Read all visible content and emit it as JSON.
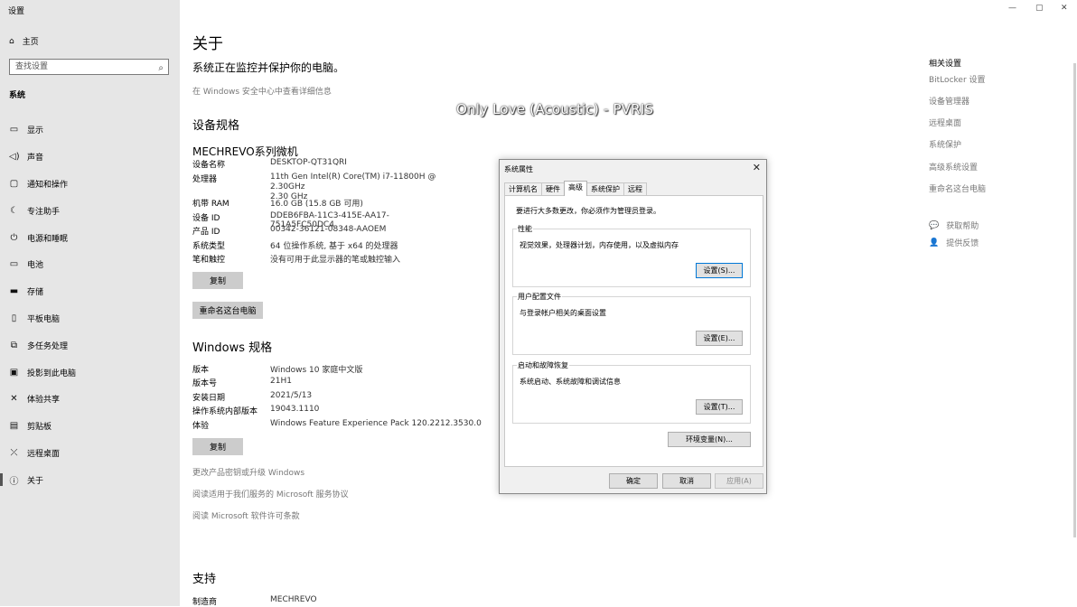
{
  "window": {
    "title": "设置",
    "controls": [
      "—",
      "▢",
      "✕"
    ]
  },
  "sidebar": {
    "home": "主页",
    "search_placeholder": "查找设置",
    "section": "系统",
    "items": [
      {
        "label": "显示",
        "icon": "display-icon"
      },
      {
        "label": "声音",
        "icon": "sound-icon"
      },
      {
        "label": "通知和操作",
        "icon": "notification-icon"
      },
      {
        "label": "专注助手",
        "icon": "moon-icon"
      },
      {
        "label": "电源和睡眠",
        "icon": "power-icon"
      },
      {
        "label": "电池",
        "icon": "battery-icon"
      },
      {
        "label": "存储",
        "icon": "storage-icon"
      },
      {
        "label": "平板电脑",
        "icon": "tablet-icon"
      },
      {
        "label": "多任务处理",
        "icon": "multitask-icon"
      },
      {
        "label": "投影到此电脑",
        "icon": "project-icon"
      },
      {
        "label": "体验共享",
        "icon": "share-icon"
      },
      {
        "label": "剪贴板",
        "icon": "clipboard-icon"
      },
      {
        "label": "远程桌面",
        "icon": "remote-icon"
      },
      {
        "label": "关于",
        "icon": "info-icon"
      }
    ]
  },
  "main": {
    "title": "关于",
    "status": "系统正在监控并保护你的电脑。",
    "security_link": "在 Windows 安全中心中查看详细信息",
    "device_spec_heading": "设备规格",
    "device_name_heading": "MECHREVO系列微机",
    "device_specs": [
      {
        "key": "设备名称",
        "value": "DESKTOP-QT31QRI"
      },
      {
        "key": "处理器",
        "value": "11th Gen Intel(R) Core(TM) i7-11800H @ 2.30GHz\n2.30 GHz"
      },
      {
        "key": "机带 RAM",
        "value": "16.0 GB (15.8 GB 可用)"
      },
      {
        "key": "设备 ID",
        "value": "DDEB6FBA-11C3-415E-AA17-751A5FC50DC4"
      },
      {
        "key": "产品 ID",
        "value": "00342-36121-08348-AAOEM"
      },
      {
        "key": "系统类型",
        "value": "64 位操作系统, 基于 x64 的处理器"
      },
      {
        "key": "笔和触控",
        "value": "没有可用于此显示器的笔或触控输入"
      }
    ],
    "copy_button": "复制",
    "rename_button": "重命名这台电脑",
    "windows_spec_heading": "Windows 规格",
    "windows_specs": [
      {
        "key": "版本",
        "value": "Windows 10 家庭中文版"
      },
      {
        "key": "版本号",
        "value": "21H1"
      },
      {
        "key": "安装日期",
        "value": "2021/5/13"
      },
      {
        "key": "操作系统内部版本",
        "value": "19043.1110"
      },
      {
        "key": "体验",
        "value": "Windows Feature Experience Pack 120.2212.3530.0"
      }
    ],
    "copy_button2": "复制",
    "links": [
      "更改产品密钥或升级 Windows",
      "阅读适用于我们服务的 Microsoft 服务协议",
      "阅读 Microsoft 软件许可条款"
    ],
    "support_heading": "支持",
    "support_rows": [
      {
        "key": "制造商",
        "value": "MECHREVO"
      }
    ]
  },
  "overlay_text": "Only Love (Acoustic) - PVRIS",
  "right": {
    "title": "相关设置",
    "links": [
      "BitLocker 设置",
      "设备管理器",
      "远程桌面",
      "系统保护",
      "高级系统设置",
      "重命名这台电脑"
    ],
    "help": "获取帮助",
    "feedback": "提供反馈"
  },
  "dialog": {
    "title": "系统属性",
    "tabs": [
      "计算机名",
      "硬件",
      "高级",
      "系统保护",
      "远程"
    ],
    "active_tab": 2,
    "note": "要进行大多数更改，你必须作为管理员登录。",
    "groups": [
      {
        "title": "性能",
        "desc": "视觉效果，处理器计划，内存使用，以及虚拟内存",
        "button": "设置(S)..."
      },
      {
        "title": "用户配置文件",
        "desc": "与登录帐户相关的桌面设置",
        "button": "设置(E)..."
      },
      {
        "title": "启动和故障恢复",
        "desc": "系统启动、系统故障和调试信息",
        "button": "设置(T)..."
      }
    ],
    "env_button": "环境变量(N)...",
    "ok": "确定",
    "cancel": "取消",
    "apply": "应用(A)"
  }
}
